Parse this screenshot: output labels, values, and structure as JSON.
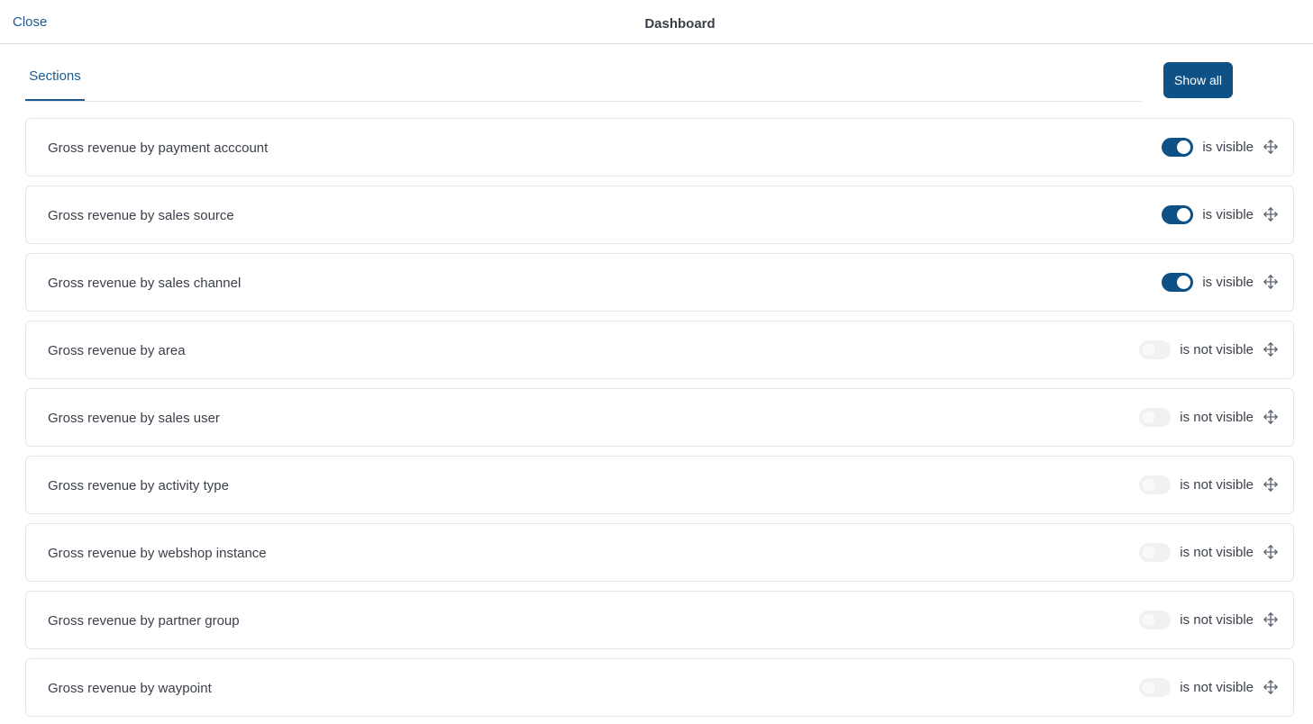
{
  "header": {
    "close_label": "Close",
    "title": "Dashboard"
  },
  "tabs": [
    {
      "label": "Sections",
      "active": true
    }
  ],
  "toolbar": {
    "show_all_label": "Show all"
  },
  "sections": [
    {
      "label": "Gross revenue by payment acccount",
      "visible": true,
      "status": "is visible"
    },
    {
      "label": "Gross revenue by sales source",
      "visible": true,
      "status": "is visible"
    },
    {
      "label": "Gross revenue by sales channel",
      "visible": true,
      "status": "is visible"
    },
    {
      "label": "Gross revenue by area",
      "visible": false,
      "status": "is not visible"
    },
    {
      "label": "Gross revenue by sales user",
      "visible": false,
      "status": "is not visible"
    },
    {
      "label": "Gross revenue by activity type",
      "visible": false,
      "status": "is not visible"
    },
    {
      "label": "Gross revenue by webshop instance",
      "visible": false,
      "status": "is not visible"
    },
    {
      "label": "Gross revenue by partner group",
      "visible": false,
      "status": "is not visible"
    },
    {
      "label": "Gross revenue by waypoint",
      "visible": false,
      "status": "is not visible"
    }
  ],
  "icons": {
    "drag_handle": "move-arrows-icon"
  },
  "colors": {
    "accent": "#0e5187",
    "link": "#1d5a8e",
    "toggle_off": "#f0f1f3"
  }
}
